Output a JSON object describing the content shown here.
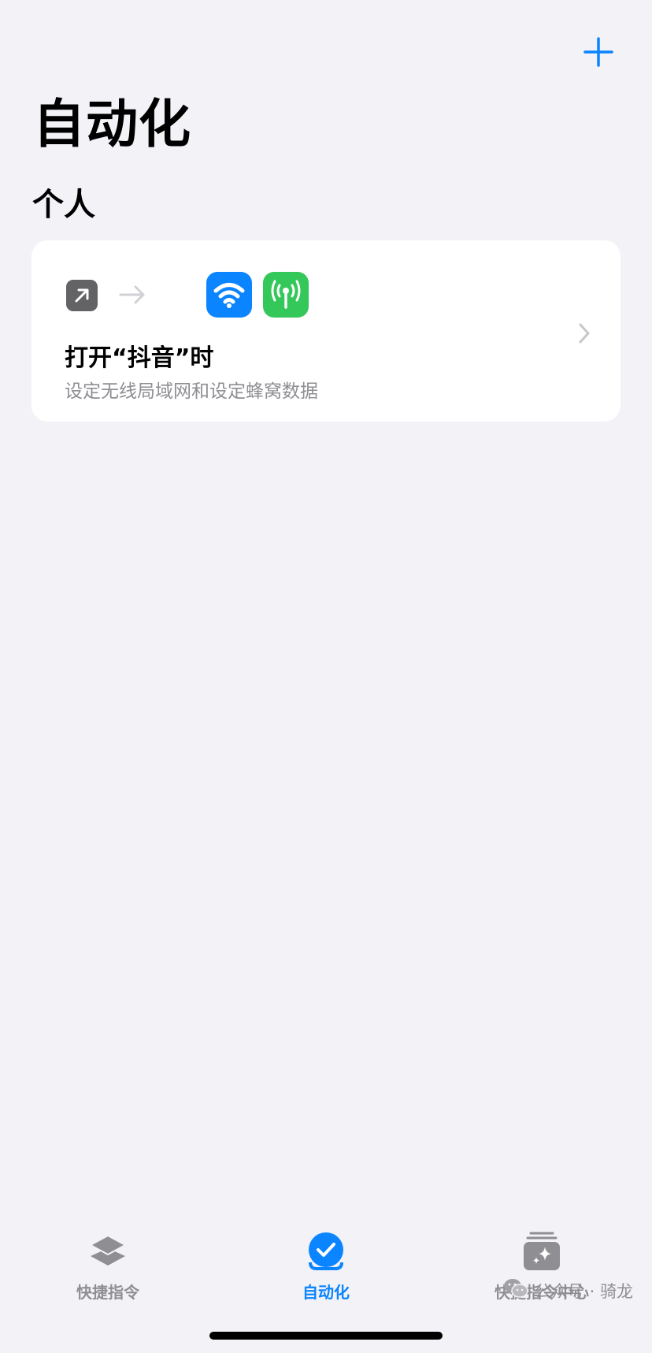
{
  "header": {
    "add_icon": "plus-icon",
    "title": "自动化"
  },
  "section": {
    "title": "个人"
  },
  "automation_card": {
    "trigger_icon": "app-open-arrow-icon",
    "flow_icon": "arrow-right-icon",
    "action_icons": [
      "wifi-icon",
      "cellular-icon"
    ],
    "title": "打开“抖音”时",
    "subtitle": "设定无线局域网和设定蜂窝数据",
    "chevron_icon": "chevron-right-icon"
  },
  "tabbar": {
    "tabs": [
      {
        "label": "快捷指令",
        "icon": "layers-icon",
        "active": false
      },
      {
        "label": "自动化",
        "icon": "checkmark-circle-icon",
        "active": true
      },
      {
        "label": "快捷指令中心",
        "icon": "gallery-sparkle-icon",
        "active": false
      }
    ]
  },
  "watermark": {
    "text": "公众号 · 骑龙",
    "icon": "wechat-icon"
  },
  "colors": {
    "background": "#f2f2f7",
    "accent": "#0a84ff",
    "wifi": "#0a84ff",
    "cellular": "#34c759",
    "inactive": "#8e8e93",
    "trigger": "#636366"
  }
}
